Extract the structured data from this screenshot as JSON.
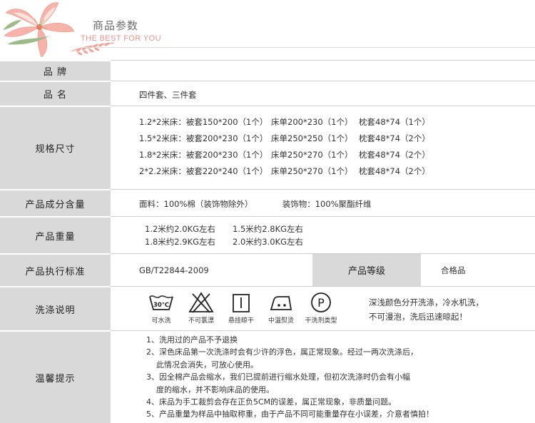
{
  "header": {
    "title": "商品参数",
    "subtitle": "THE BEST FOR YOU"
  },
  "rows": {
    "brand": {
      "label": "品 牌",
      "value": ""
    },
    "name": {
      "label": "品 名",
      "value": "四件套、三件套"
    },
    "spec": {
      "label": "规格尺寸",
      "lines": [
        {
          "bed": "1.2*2米床：被套150*200（1个）",
          "sheet": "床单200*230（1个）",
          "pillow": "枕套48*74（1个）"
        },
        {
          "bed": "1.5*2米床：被套200*230（1个）",
          "sheet": "床单250*250（1个）",
          "pillow": "枕套48*74（2个）"
        },
        {
          "bed": "1.8*2米床：被套200*230（1个）",
          "sheet": "床单250*270（1个）",
          "pillow": "枕套48*74（2个）"
        },
        {
          "bed": "2*2.2米床：被套220*240（1个）",
          "sheet": "床单250*270（1个）",
          "pillow": "枕套48*74（2个）"
        }
      ]
    },
    "composition": {
      "label": "产品成分含量",
      "fabric": "面料：100%棉（装饰物除外）",
      "decor": "装饰物：100%聚酯纤维"
    },
    "weight": {
      "label": "产品重量",
      "items": [
        "1.2米约2.0KG左右",
        "1.5米约2.8KG左右",
        "1.8米约2.9KG左右",
        "2.0米约3.0KG左右"
      ]
    },
    "standard": {
      "label": "产品执行标准",
      "value": "GB/T22844-2009",
      "grade_label": "产品等级",
      "grade_value": "合格品"
    },
    "washing": {
      "label": "洗涤说明",
      "icons": [
        {
          "icon": "wash-30-icon",
          "caption": "可水洗",
          "temp": "30℃"
        },
        {
          "icon": "no-bleach-icon",
          "caption": "不可氯漂"
        },
        {
          "icon": "hang-dry-icon",
          "caption": "悬挂晾干"
        },
        {
          "icon": "iron-medium-icon",
          "caption": "中温熨烫"
        },
        {
          "icon": "dry-clean-p-icon",
          "caption": "干洗剂类型",
          "letter": "P"
        }
      ],
      "note_line1": "深浅颜色分开洗涤，冷水机洗，",
      "note_line2": "不可漫泡，洗后迅速晾起！"
    },
    "tips": {
      "label": "温馨提示",
      "lines": [
        "1、洗用过的产品不予退换",
        "2、深色床品第一次洗涤时会有少许的浮色，属正常现象。经过一两次洗涤后，",
        "此情况会消失，可放心使用。",
        "3、因全棉产品会缩水，我们已提前进行缩水处理，但初次洗涤时仍会有小幅",
        "度的缩水，并不影响床品的使用。",
        "4、床品为手工裁剪会存在正负5CM的误差，属正常现象，非质量问题。",
        "5、产品重量为样品中抽取称重，由于产品不同可能重量存在小误差，介意者慎拍！"
      ]
    }
  },
  "colors": {
    "label_bg": "#d9d9d9",
    "subtitle": "#e8928b",
    "flower": "#f08a7e"
  }
}
